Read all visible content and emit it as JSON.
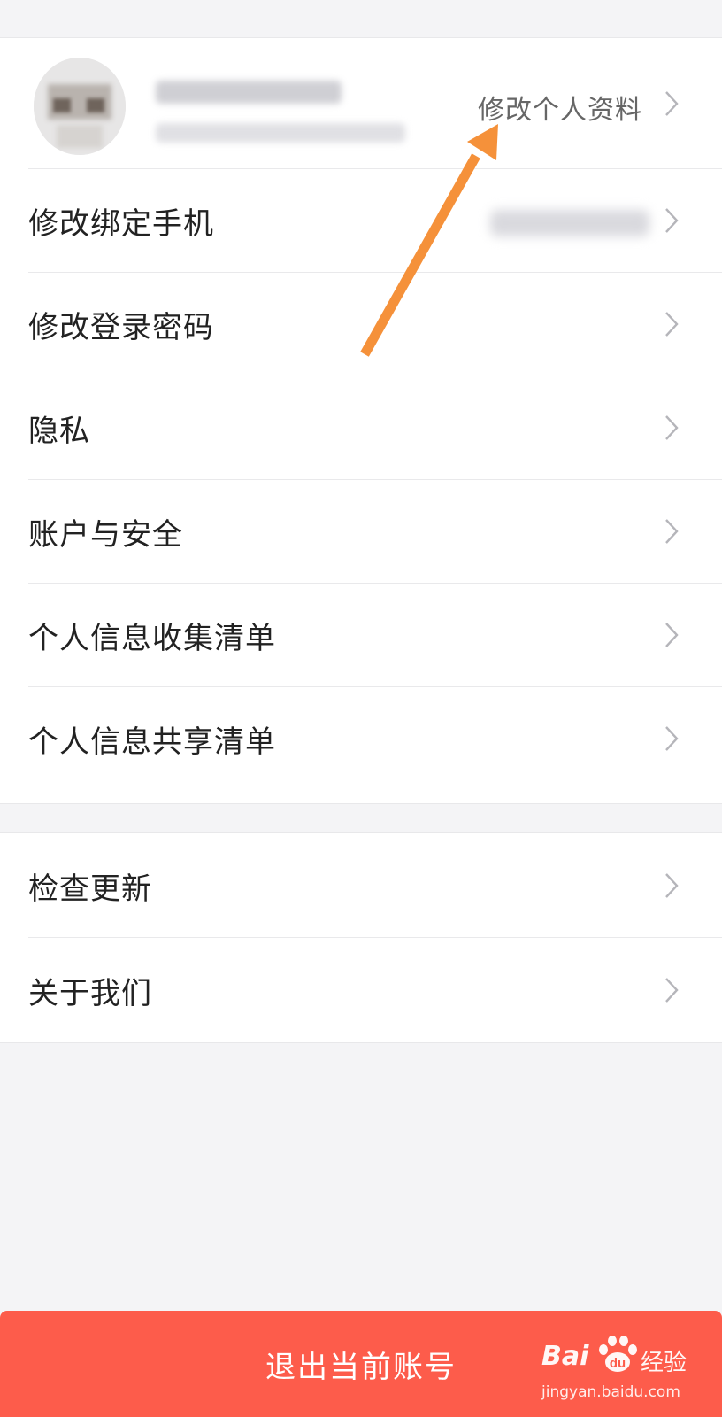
{
  "profile": {
    "edit_link": "修改个人资料"
  },
  "menu_group_1": [
    {
      "label": "修改绑定手机"
    },
    {
      "label": "修改登录密码"
    },
    {
      "label": "隐私"
    },
    {
      "label": "账户与安全"
    },
    {
      "label": "个人信息收集清单"
    },
    {
      "label": "个人信息共享清单"
    }
  ],
  "menu_group_2": [
    {
      "label": "检查更新"
    },
    {
      "label": "关于我们"
    }
  ],
  "logout": {
    "label": "退出当前账号"
  },
  "watermark": {
    "main": "Bai",
    "suffix": "经验",
    "url": "jingyan.baidu.com"
  },
  "colors": {
    "accent_button": "#fd5c4b",
    "annotation_arrow": "#f5913a",
    "background": "#f4f4f6"
  },
  "icons": {
    "row_chevron": "chevron-right-icon",
    "annotation": "arrow-annotation-icon"
  }
}
